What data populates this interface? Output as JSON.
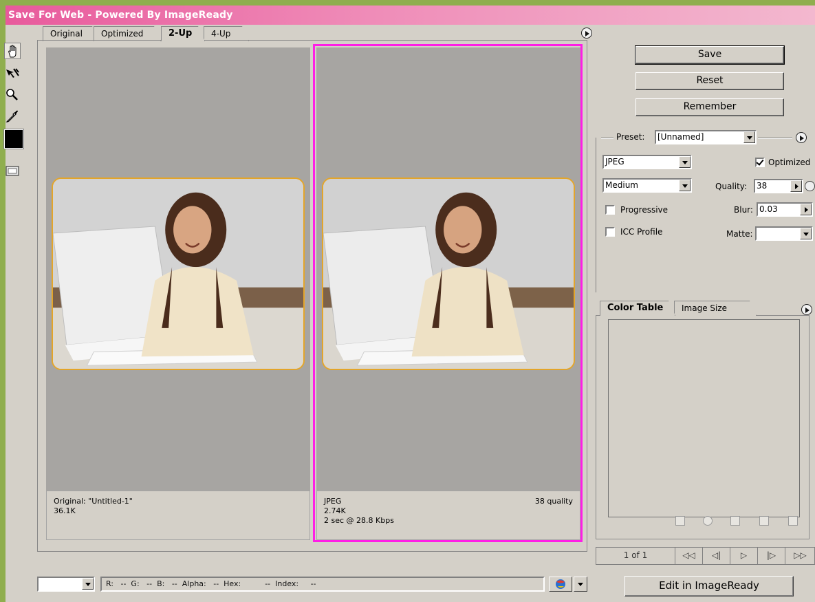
{
  "window": {
    "title": "Save For Web - Powered By ImageReady"
  },
  "tabs": [
    "Original",
    "Optimized",
    "2-Up",
    "4-Up"
  ],
  "active_tab": "2-Up",
  "panes": {
    "left": {
      "line1": "Original: \"Untitled-1\"",
      "line2": "36.1K"
    },
    "right": {
      "format": "JPEG",
      "size": "2.74K",
      "time": "2 sec @ 28.8 Kbps",
      "quality_note": "38 quality"
    }
  },
  "buttons": {
    "save": "Save",
    "reset": "Reset",
    "remember": "Remember",
    "edit": "Edit in ImageReady"
  },
  "settings": {
    "preset_label": "Preset:",
    "preset_value": "[Unnamed]",
    "format": "JPEG",
    "quality_level": "Medium",
    "optimized_label": "Optimized",
    "optimized_checked": true,
    "quality_label": "Quality:",
    "quality_value": "38",
    "blur_label": "Blur:",
    "blur_value": "0.03",
    "matte_label": "Matte:",
    "matte_value": "",
    "progressive_label": "Progressive",
    "progressive_checked": false,
    "icc_label": "ICC Profile",
    "icc_checked": false
  },
  "panel_tabs": [
    "Color Table",
    "Image Size"
  ],
  "pager": {
    "label": "1 of 1",
    "first": "◁◁",
    "prev": "◁|",
    "play": "▷",
    "next": "|▷",
    "last": "▷▷"
  },
  "readout": "R:   --  G:   --  B:   --  Alpha:   --  Hex:          --  Index:     --",
  "colors": {
    "title_start": "#e85a9c",
    "selection": "#ff1ee6",
    "photo_border": "#e3a52a",
    "canvas": "#a7a5a2"
  },
  "icons": [
    "hand-icon",
    "slice-select-icon",
    "zoom-icon",
    "eyedropper-icon",
    "eyedropper-color-icon",
    "toggle-slices-icon",
    "browser-icon"
  ]
}
